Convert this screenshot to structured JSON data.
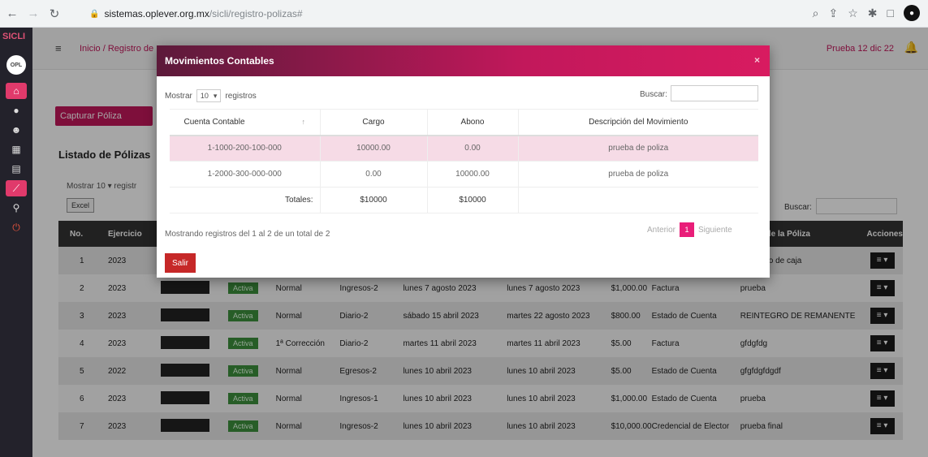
{
  "browser": {
    "url_host": "sistemas.oplever.org.mx",
    "url_path": "/sicli/registro-polizas#"
  },
  "app": {
    "logo": "SICLI",
    "breadcrumb": "Inicio / Registro de",
    "user": "Prueba 12 dic 22"
  },
  "page": {
    "capture_button": "Capturar Póliza",
    "list_title": "Listado de Pólizas",
    "show_label": "Mostrar",
    "show_value": "10",
    "show_suffix": "registr",
    "excel_button": "Excel",
    "search_label": "Buscar:",
    "table_headers": [
      "No.",
      "Ejercicio",
      "",
      "",
      "",
      "",
      "",
      "",
      "",
      "",
      "ión de la Póliza",
      "Acciones"
    ],
    "rows": [
      {
        "no": "1",
        "year": "2023",
        "status": "",
        "type": "",
        "subtype": "",
        "date1": "",
        "date2": "",
        "amount": "",
        "doc": "",
        "desc": "fondo fijo de caja"
      },
      {
        "no": "2",
        "year": "2023",
        "status": "Activa",
        "type": "Normal",
        "subtype": "Ingresos-2",
        "date1": "lunes 7 agosto 2023",
        "date2": "lunes 7 agosto 2023",
        "amount": "$1,000.00",
        "doc": "Factura",
        "desc": "prueba"
      },
      {
        "no": "3",
        "year": "2023",
        "status": "Activa",
        "type": "Normal",
        "subtype": "Diario-2",
        "date1": "sábado 15 abril 2023",
        "date2": "martes 22 agosto 2023",
        "amount": "$800.00",
        "doc": "Estado de Cuenta",
        "desc": "REINTEGRO DE REMANENTE"
      },
      {
        "no": "4",
        "year": "2023",
        "status": "Activa",
        "type": "1ª Corrección",
        "subtype": "Diario-2",
        "date1": "martes 11 abril 2023",
        "date2": "martes 11 abril 2023",
        "amount": "$5.00",
        "doc": "Factura",
        "desc": "gfdgfdg"
      },
      {
        "no": "5",
        "year": "2022",
        "status": "Activa",
        "type": "Normal",
        "subtype": "Egresos-2",
        "date1": "lunes 10 abril 2023",
        "date2": "lunes 10 abril 2023",
        "amount": "$5.00",
        "doc": "Estado de Cuenta",
        "desc": "gfgfdgfdgdf"
      },
      {
        "no": "6",
        "year": "2023",
        "status": "Activa",
        "type": "Normal",
        "subtype": "Ingresos-1",
        "date1": "lunes 10 abril 2023",
        "date2": "lunes 10 abril 2023",
        "amount": "$1,000.00",
        "doc": "Estado de Cuenta",
        "desc": "prueba"
      },
      {
        "no": "7",
        "year": "2023",
        "status": "Activa",
        "type": "Normal",
        "subtype": "Ingresos-2",
        "date1": "lunes 10 abril 2023",
        "date2": "lunes 10 abril 2023",
        "amount": "$10,000.00",
        "doc": "Credencial de Elector",
        "desc": "prueba final"
      }
    ]
  },
  "modal": {
    "title": "Movimientos Contables",
    "close": "×",
    "show_label": "Mostrar",
    "show_value": "10",
    "show_suffix": "registros",
    "search_label": "Buscar:",
    "headers": [
      "Cuenta Contable",
      "Cargo",
      "Abono",
      "Descripción del Movimiento"
    ],
    "rows": [
      {
        "account": "1-1000-200-100-000",
        "cargo": "10000.00",
        "abono": "0.00",
        "desc": "prueba de poliza"
      },
      {
        "account": "1-2000-300-000-000",
        "cargo": "0.00",
        "abono": "10000.00",
        "desc": "prueba de poliza"
      }
    ],
    "totals_label": "Totales:",
    "total_cargo": "$10000",
    "total_abono": "$10000",
    "info": "Mostrando registros del 1 al 2 de un total de 2",
    "prev": "Anterior",
    "page": "1",
    "next": "Siguiente",
    "exit_button": "Salir"
  }
}
